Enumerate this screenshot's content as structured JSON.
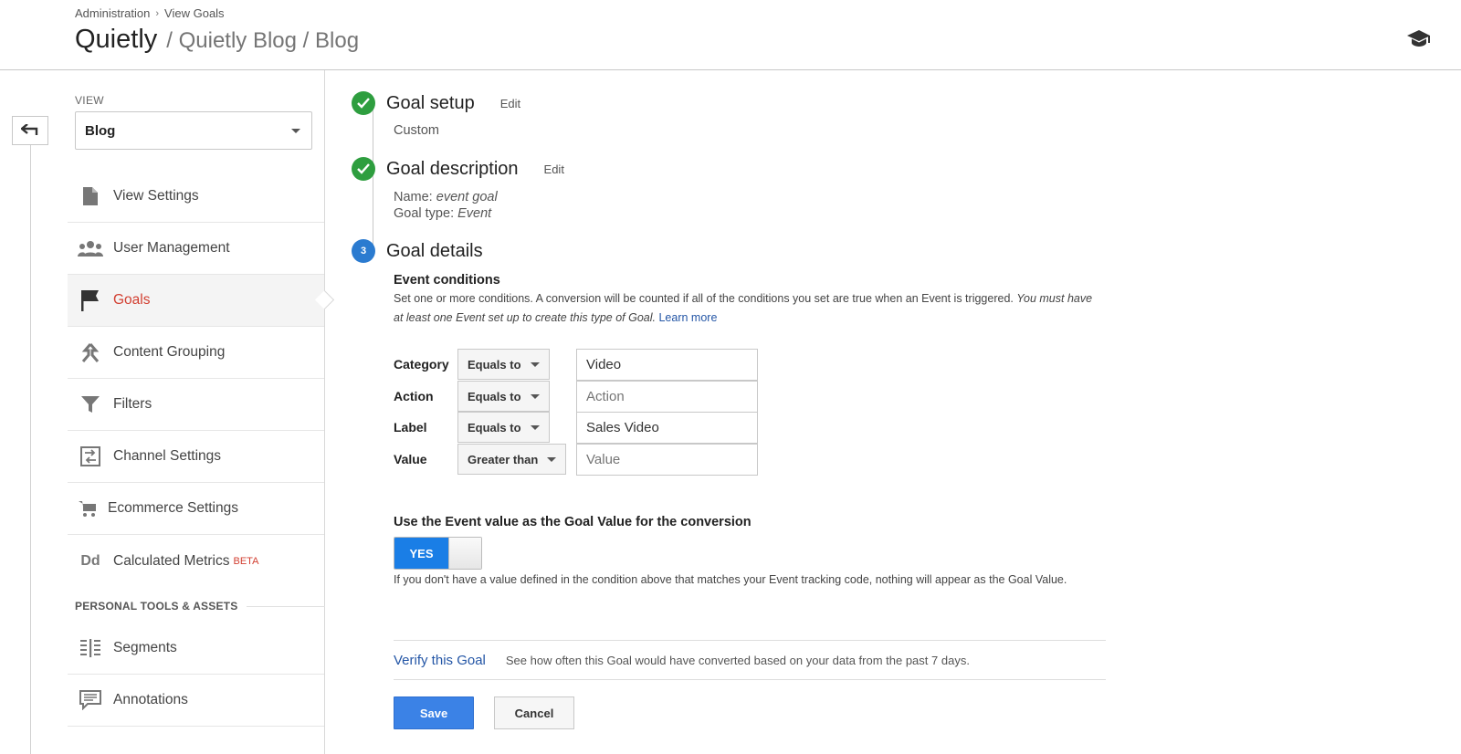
{
  "header": {
    "breadcrumb": [
      "Administration",
      "View Goals"
    ],
    "breadcrumb_sep": "›",
    "account": "Quietly",
    "property_path": "/ Quietly Blog / Blog",
    "icon": "graduation-cap-icon"
  },
  "sidebar": {
    "view_label": "VIEW",
    "view_selected": "Blog",
    "items": [
      {
        "label": "View Settings",
        "icon": "document-icon"
      },
      {
        "label": "User Management",
        "icon": "users-icon"
      },
      {
        "label": "Goals",
        "icon": "flag-icon",
        "active": true
      },
      {
        "label": "Content Grouping",
        "icon": "grouping-icon"
      },
      {
        "label": "Filters",
        "icon": "filter-icon"
      },
      {
        "label": "Channel Settings",
        "icon": "channel-icon"
      },
      {
        "label": "Ecommerce Settings",
        "icon": "cart-icon"
      },
      {
        "label": "Calculated Metrics",
        "icon": "dd-icon",
        "badge": "BETA",
        "icon_text": "Dd"
      }
    ],
    "section_title": "PERSONAL TOOLS & ASSETS",
    "tools": [
      {
        "label": "Segments",
        "icon": "segments-icon"
      },
      {
        "label": "Annotations",
        "icon": "annotation-icon"
      }
    ]
  },
  "steps": {
    "setup": {
      "title": "Goal setup",
      "edit": "Edit",
      "value": "Custom"
    },
    "description": {
      "title": "Goal description",
      "edit": "Edit",
      "name_label": "Name:",
      "name_value": "event goal",
      "type_label": "Goal type:",
      "type_value": "Event"
    },
    "details": {
      "number": "3",
      "title": "Goal details"
    }
  },
  "event_conditions": {
    "title": "Event conditions",
    "desc": "Set one or more conditions. A conversion will be counted if all of the conditions you set are true when an Event is triggered.",
    "desc_italic": "You must have at least one Event set up to create this type of Goal.",
    "learn_more": "Learn more",
    "rows": [
      {
        "label": "Category",
        "op": "Equals to",
        "value": "Video",
        "placeholder": "Category"
      },
      {
        "label": "Action",
        "op": "Equals to",
        "value": "",
        "placeholder": "Action"
      },
      {
        "label": "Label",
        "op": "Equals to",
        "value": "Sales Video",
        "placeholder": "Label"
      },
      {
        "label": "Value",
        "op": "Greater than",
        "value": "",
        "placeholder": "Value"
      }
    ]
  },
  "use_value": {
    "title": "Use the Event value as the Goal Value for the conversion",
    "toggle_label": "YES",
    "toggle_on": true,
    "desc": "If you don't have a value defined in the condition above that matches your Event tracking code, nothing will appear as the Goal Value."
  },
  "verify": {
    "link": "Verify this Goal",
    "desc": "See how often this Goal would have converted based on your data from the past 7 days."
  },
  "actions": {
    "save": "Save",
    "cancel": "Cancel"
  },
  "colors": {
    "accent": "#1a7ee6",
    "active_nav": "#d23f31",
    "done": "#2e9e3f"
  }
}
